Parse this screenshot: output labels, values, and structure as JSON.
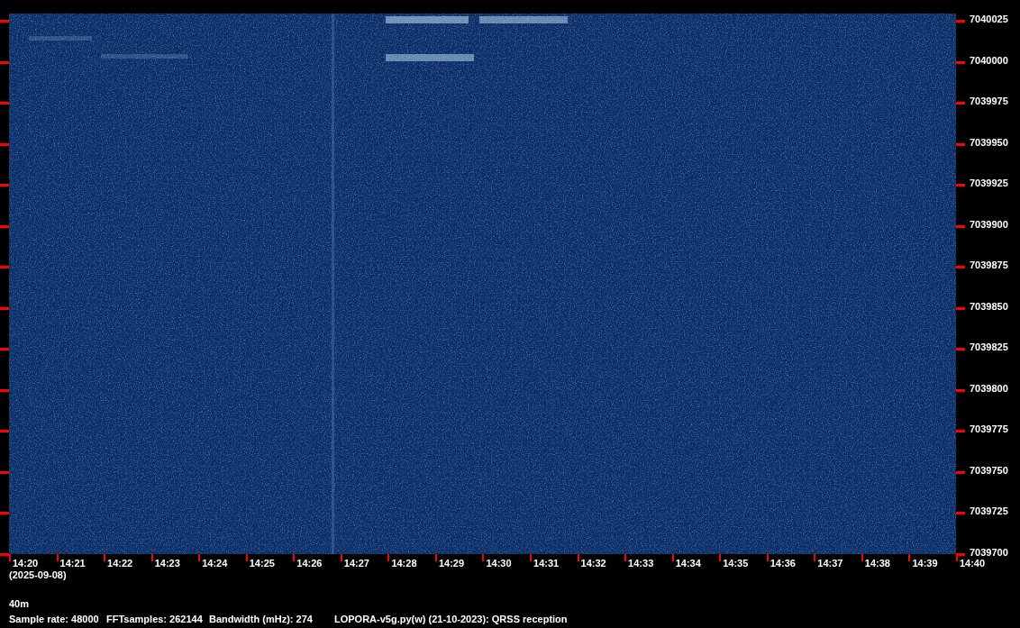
{
  "frequency_axis": {
    "labels": [
      "7040025",
      "7040000",
      "7039975",
      "7039950",
      "7039925",
      "7039900",
      "7039875",
      "7039850",
      "7039825",
      "7039800",
      "7039775",
      "7039750",
      "7039725",
      "7039700"
    ]
  },
  "time_axis": {
    "labels": [
      "14:20",
      "14:21",
      "14:22",
      "14:23",
      "14:24",
      "14:25",
      "14:26",
      "14:27",
      "14:28",
      "14:29",
      "14:30",
      "14:31",
      "14:32",
      "14:33",
      "14:34",
      "14:35",
      "14:36",
      "14:37",
      "14:38",
      "14:39",
      "14:40"
    ]
  },
  "date": "(2025-09-08)",
  "band": "40m",
  "info": [
    "Sample rate: 48000",
    "FFTsamples: 262144",
    "Bandwidth (mHz): 274",
    "LOPORA-v5g.py(w) (21-10-2023): QRSS reception"
  ]
}
